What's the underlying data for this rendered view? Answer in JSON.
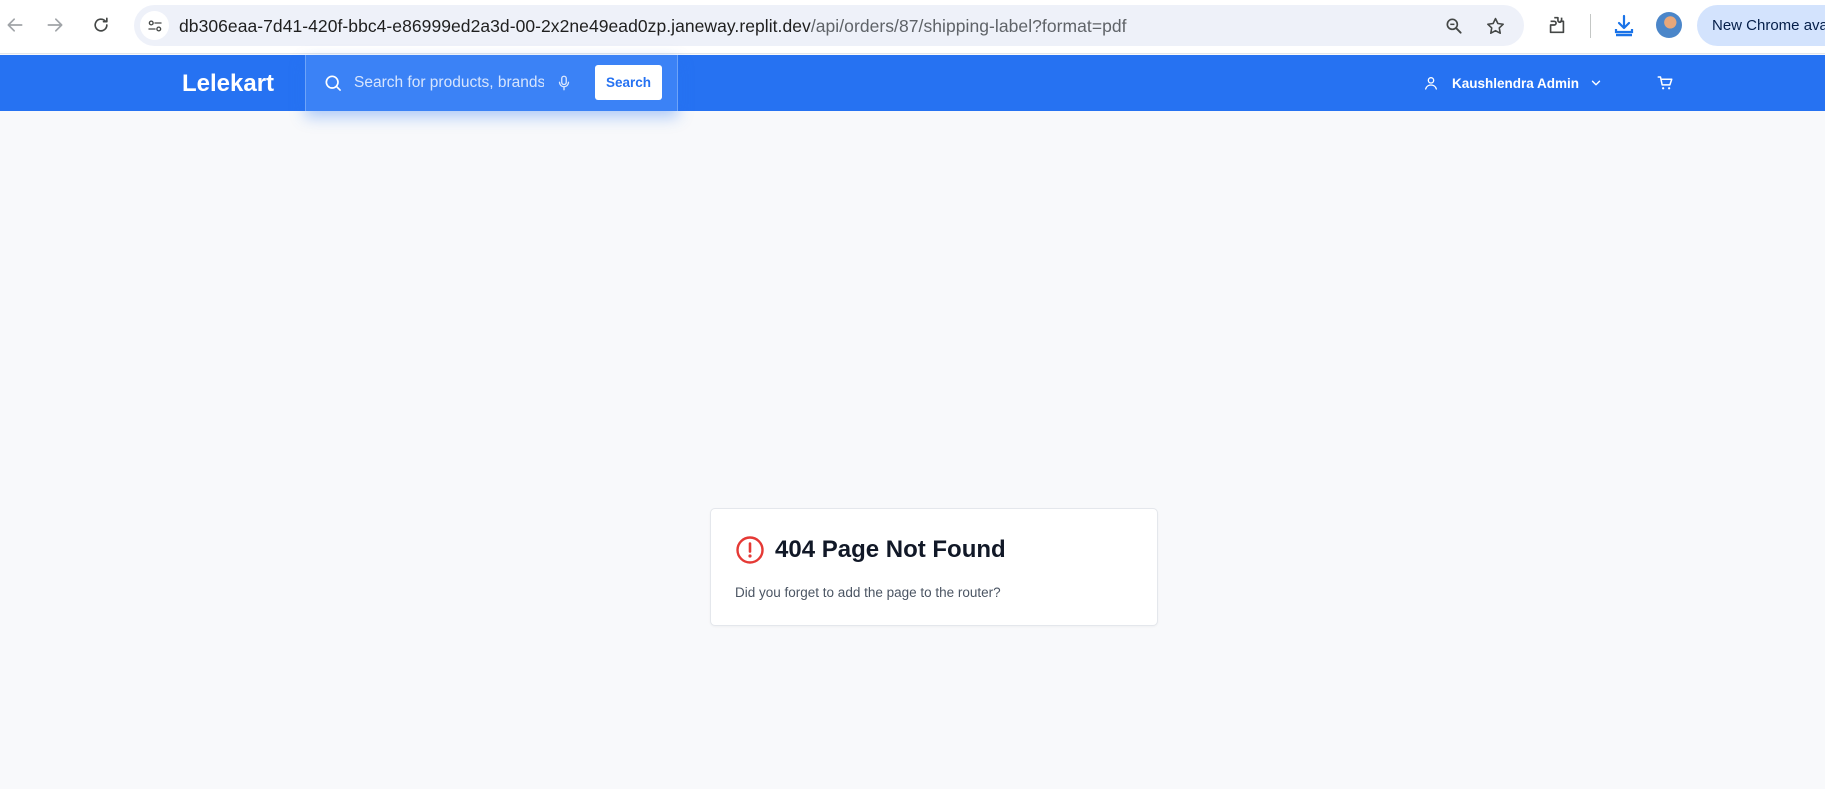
{
  "browser": {
    "url_host": "db306eaa-7d41-420f-bbc4-e86999ed2a3d-00-2x2ne49ead0zp.janeway.replit.dev",
    "url_path": "/api/orders/87/shipping-label?format=pdf",
    "update_label": "New Chrome ava",
    "icons": [
      "back-icon",
      "forward-icon",
      "reload-icon",
      "site-info-icon",
      "zoom-icon",
      "bookmark-star-icon",
      "extensions-icon",
      "download-icon",
      "profile-avatar"
    ]
  },
  "header": {
    "brand": "Lelekart",
    "search": {
      "placeholder": "Search for products, brands and more",
      "button_label": "Search"
    },
    "user_name": "Kaushlendra Admin",
    "colors": {
      "header_bg": "#2672f2",
      "search_bg": "#3b82f6"
    }
  },
  "error_card": {
    "title": "404 Page Not Found",
    "message": "Did you forget to add the page to the router?",
    "icon_color": "#e53935"
  }
}
